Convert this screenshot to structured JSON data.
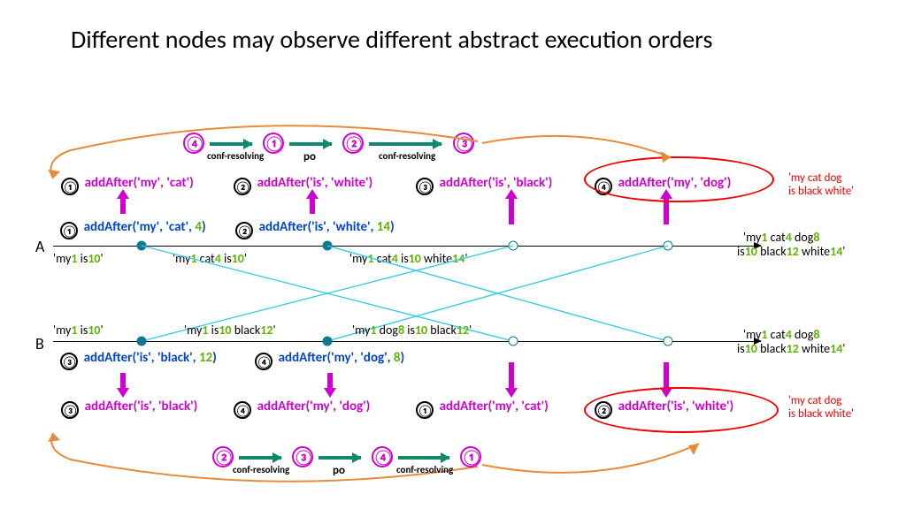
{
  "title": "Different nodes may observe different abstract execution orders",
  "po": "po",
  "conf": "conf-resolving",
  "n1": "①",
  "n2": "②",
  "n3": "③",
  "n4": "④",
  "top_abs": {
    "a1": "addAfter('my', 'cat')",
    "a2": "addAfter('is', 'white')",
    "a3": "addAfter('is', 'black')",
    "a4": "addAfter('my', 'dog')"
  },
  "bot_abs": {
    "a1": "addAfter('my', 'cat')",
    "a2": "addAfter('is', 'white')",
    "a3": "addAfter('is', 'black')",
    "a4": "addAfter('my', 'dog')"
  },
  "A": {
    "label": "A",
    "op1_pre": "addAfter('my', 'cat', ",
    "op1_n": "4",
    "op1_post": ")",
    "op2_pre": "addAfter('is', 'white', ",
    "op2_n": "14",
    "op2_post": ")",
    "s0": {
      "p": [
        "'my",
        "1",
        " is",
        "10",
        "'"
      ]
    },
    "s1": {
      "p": [
        "'my",
        "1",
        " cat",
        "4",
        " is",
        "10",
        "'"
      ]
    },
    "s2": {
      "p": [
        "'my",
        "1",
        " cat",
        "4",
        " is",
        "10",
        " white",
        "14",
        "'"
      ]
    },
    "s_end_l1": {
      "p": [
        "'my",
        "1",
        " cat",
        "4",
        " dog",
        "8"
      ]
    },
    "s_end_l2": {
      "p": [
        "is",
        "10",
        " black",
        "12",
        " white",
        "14",
        "'"
      ]
    }
  },
  "B": {
    "label": "B",
    "op3_pre": "addAfter('is', 'black', ",
    "op3_n": "12",
    "op3_post": ")",
    "op4_pre": "addAfter('my', 'dog', ",
    "op4_n": "8",
    "op4_post": ")",
    "s0": {
      "p": [
        "'my",
        "1",
        " is",
        "10",
        "'"
      ]
    },
    "s1": {
      "p": [
        "'my",
        "1",
        " is",
        "10",
        " black",
        "12",
        "'"
      ]
    },
    "s2": {
      "p": [
        "'my",
        "1",
        " dog",
        "8",
        " is",
        "10",
        " black",
        "12",
        "'"
      ]
    },
    "s_end_l1": {
      "p": [
        "'my",
        "1",
        " cat",
        "4",
        " dog",
        "8"
      ]
    },
    "s_end_l2": {
      "p": [
        "is",
        "10",
        " black",
        "12",
        " white",
        "14",
        "'"
      ]
    }
  },
  "result": "'my cat dog\nis black white'",
  "chart_data": {
    "type": "table",
    "title": "Different nodes may observe different abstract execution orders",
    "nodes": [
      "A",
      "B"
    ],
    "operations": [
      {
        "id": 1,
        "node": "A",
        "op": "addAfter",
        "after": "my",
        "word": "cat",
        "tag": 4
      },
      {
        "id": 2,
        "node": "A",
        "op": "addAfter",
        "after": "is",
        "word": "white",
        "tag": 14
      },
      {
        "id": 3,
        "node": "B",
        "op": "addAfter",
        "after": "is",
        "word": "black",
        "tag": 12
      },
      {
        "id": 4,
        "node": "B",
        "op": "addAfter",
        "after": "my",
        "word": "dog",
        "tag": 8
      }
    ],
    "A_observed_order": [
      4,
      1,
      2,
      3
    ],
    "A_order_edges": [
      {
        "from": 4,
        "to": 1,
        "label": "conf-resolving"
      },
      {
        "from": 1,
        "to": 2,
        "label": "po"
      },
      {
        "from": 2,
        "to": 3,
        "label": "conf-resolving"
      }
    ],
    "B_observed_order": [
      2,
      3,
      4,
      1
    ],
    "B_order_edges": [
      {
        "from": 2,
        "to": 3,
        "label": "conf-resolving"
      },
      {
        "from": 3,
        "to": 4,
        "label": "po"
      },
      {
        "from": 4,
        "to": 1,
        "label": "conf-resolving"
      }
    ],
    "A_states": [
      "my1 is10",
      "my1 cat4 is10",
      "my1 cat4 is10 white14",
      "my1 cat4 dog8 is10 black12 white14"
    ],
    "B_states": [
      "my1 is10",
      "my1 is10 black12",
      "my1 dog8 is10 black12",
      "my1 cat4 dog8 is10 black12 white14"
    ],
    "converged_result": "my cat dog is black white"
  }
}
